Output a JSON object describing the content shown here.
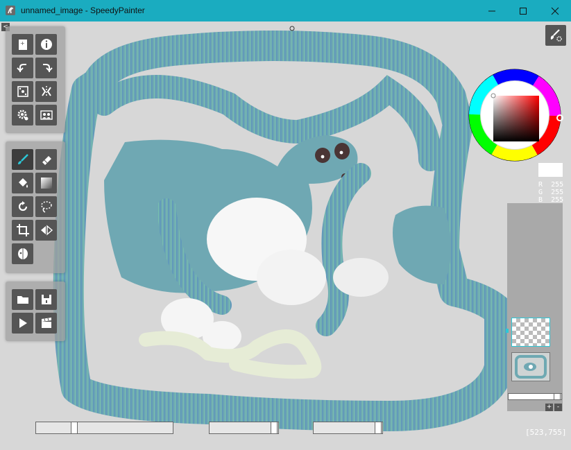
{
  "window": {
    "title": "unnamed_image - SpeedyPainter",
    "app_icon": "speedypainter-logo"
  },
  "panel_toggle_label": "<",
  "toolbar": {
    "file_tools": [
      "new-image-icon",
      "info-icon",
      "undo-icon",
      "redo-icon",
      "canvas-size-icon",
      "mirror-icon",
      "gear-icon",
      "reference-icon"
    ],
    "paint_tools": [
      "brush-icon",
      "eraser-icon",
      "fill-icon",
      "gradient-icon",
      "rotate-icon",
      "lasso-icon",
      "crop-icon",
      "symmetry-icon",
      "mask-icon"
    ],
    "io_tools": [
      "open-folder-icon",
      "save-icon",
      "play-icon",
      "record-icon"
    ]
  },
  "color": {
    "r_label": "R",
    "g_label": "G",
    "b_label": "B",
    "r": "255",
    "g": "255",
    "b": "255",
    "current": "#ffffff"
  },
  "layers": {
    "add_label": "+",
    "remove_label": "-"
  },
  "sliders": {
    "size": 0.27,
    "opacity": 0.97,
    "flow": 0.93
  },
  "status": {
    "coords": "[523,755]"
  },
  "colors": {
    "titlebar": "#1aacc0",
    "accent": "#2cc8d8",
    "tool_bg": "#555555"
  }
}
